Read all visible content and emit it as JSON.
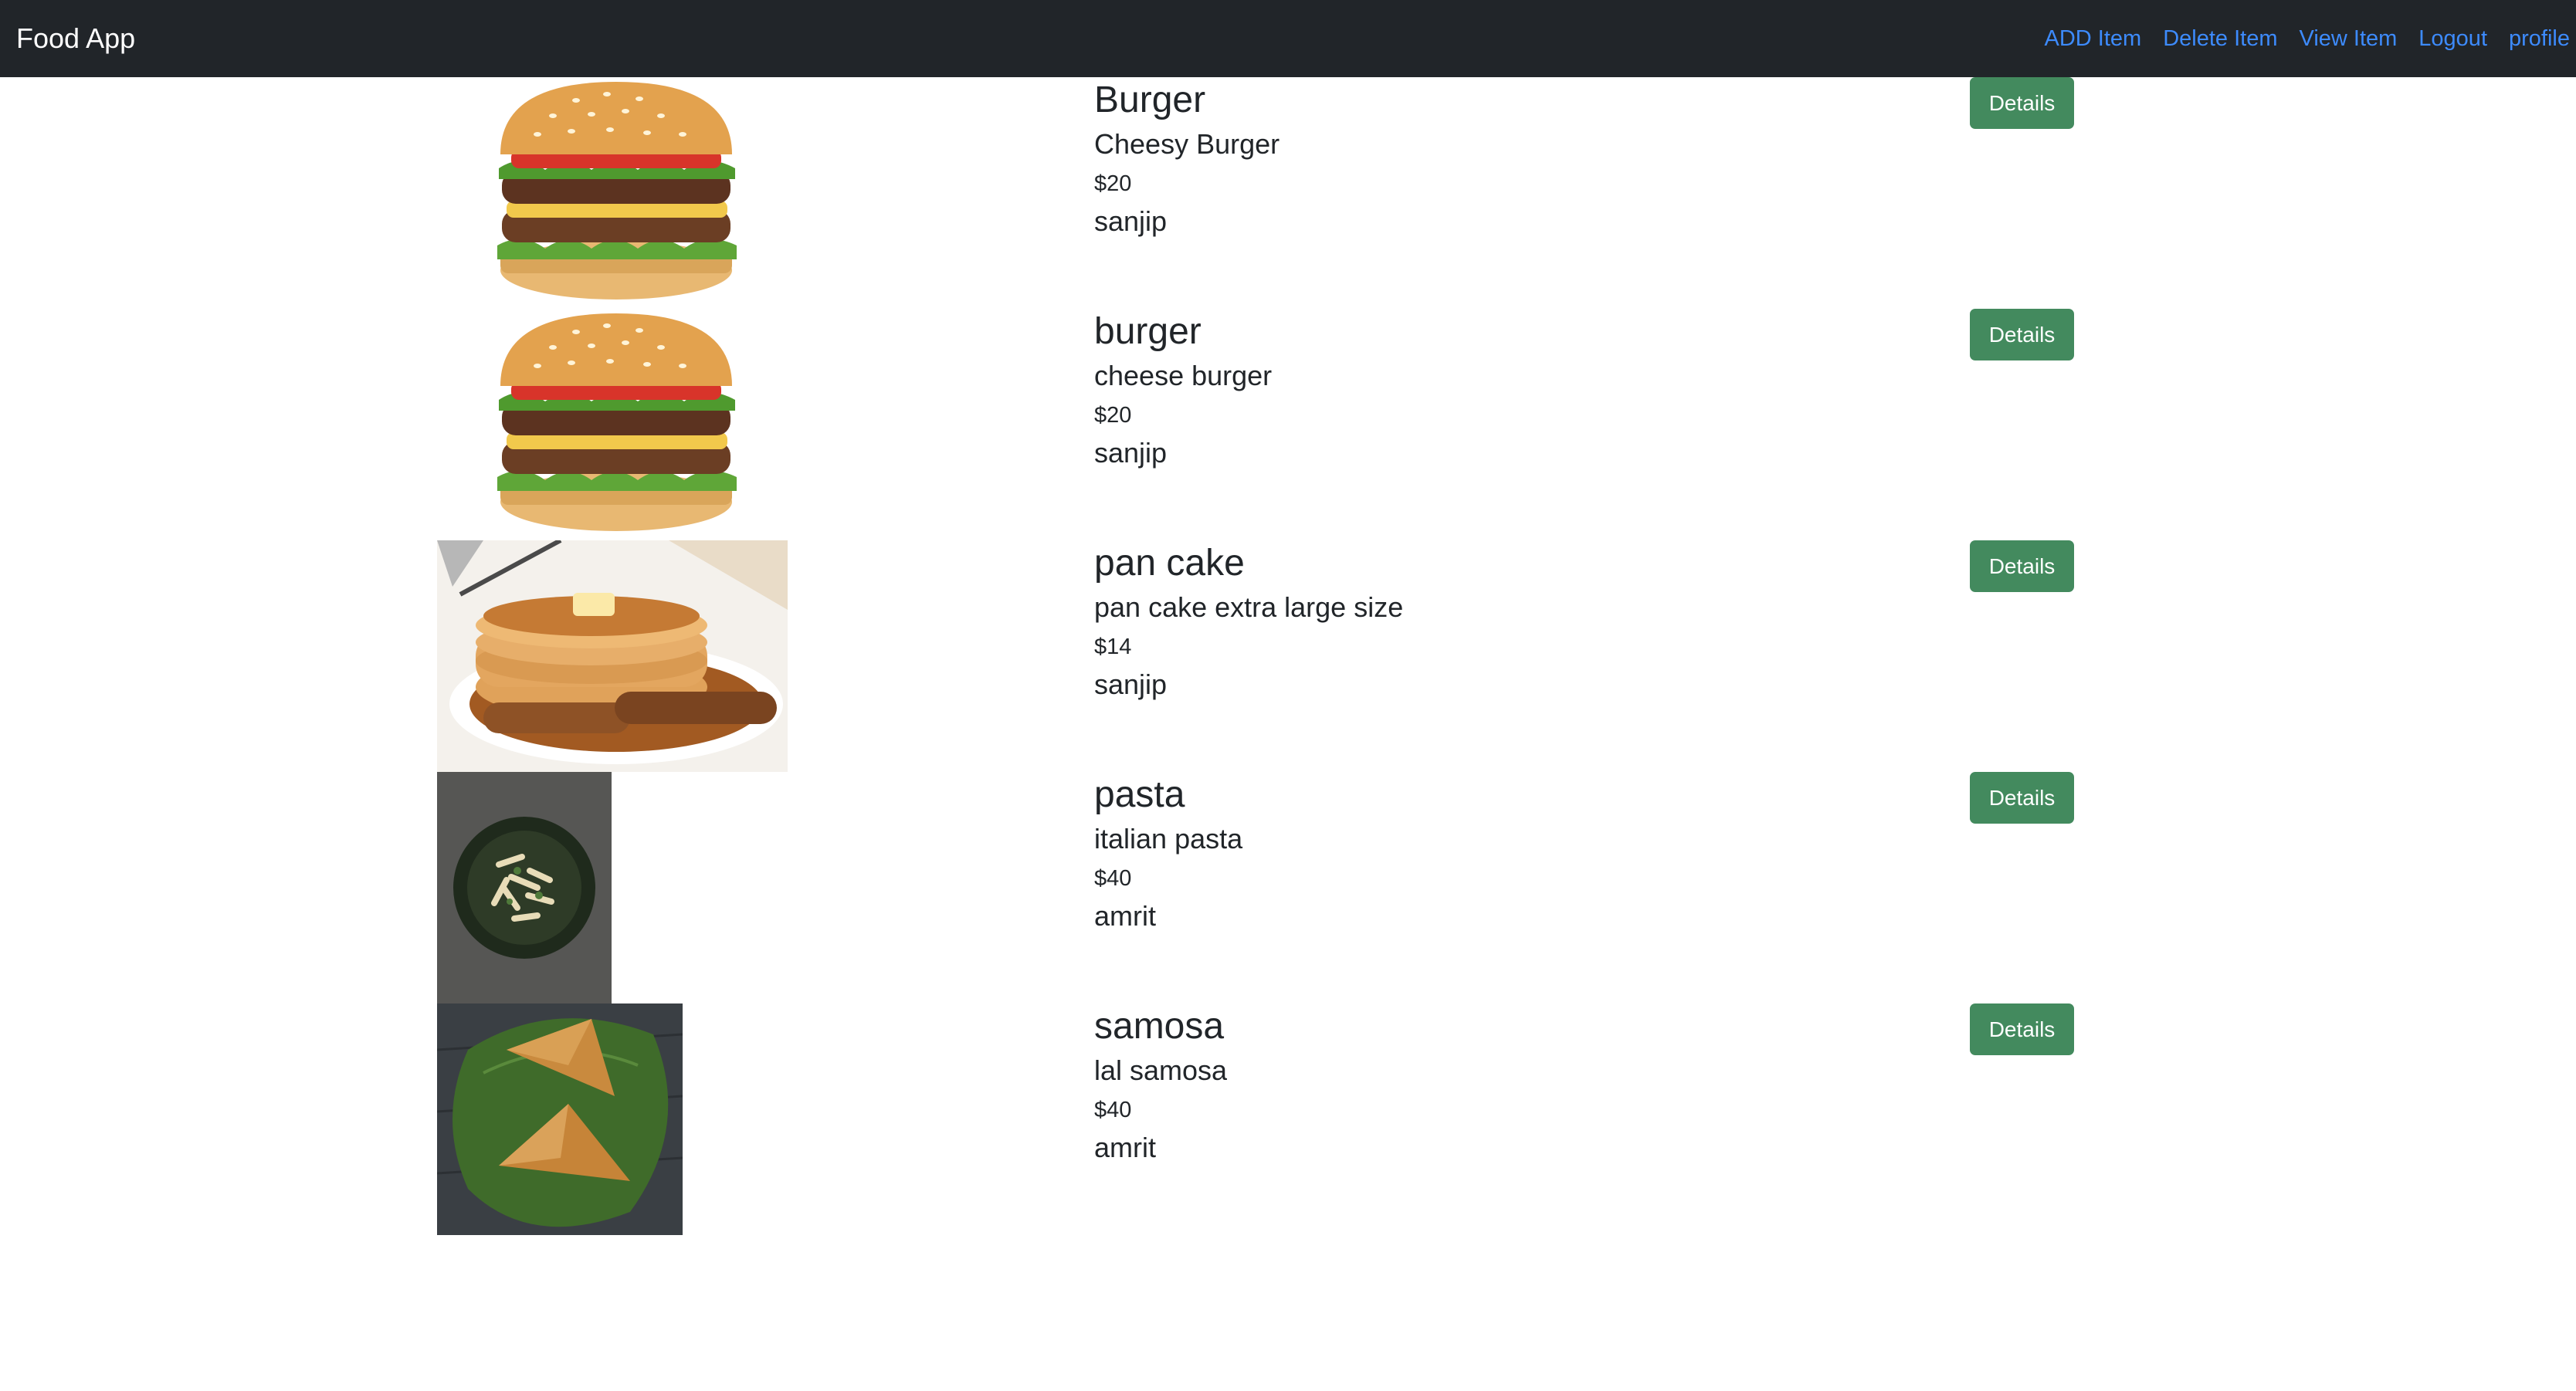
{
  "navbar": {
    "brand": "Food App",
    "links": [
      "ADD Item",
      "Delete Item",
      "View Item",
      "Logout",
      "profile"
    ]
  },
  "items": [
    {
      "title": "Burger",
      "description": "Cheesy Burger",
      "price": "$20",
      "owner": "sanjip",
      "button": "Details",
      "image": "burger-image"
    },
    {
      "title": "burger",
      "description": "cheese burger",
      "price": "$20",
      "owner": "sanjip",
      "button": "Details",
      "image": "burger-image"
    },
    {
      "title": "pan cake",
      "description": "pan cake extra large size",
      "price": "$14",
      "owner": "sanjip",
      "button": "Details",
      "image": "pancake-image"
    },
    {
      "title": "pasta",
      "description": "italian pasta",
      "price": "$40",
      "owner": "amrit",
      "button": "Details",
      "image": "pasta-image"
    },
    {
      "title": "samosa",
      "description": "lal samosa",
      "price": "$40",
      "owner": "amrit",
      "button": "Details",
      "image": "samosa-image"
    }
  ],
  "colors": {
    "navbar": "#212529",
    "link": "#3d8bfd",
    "button": "#438a5e"
  }
}
